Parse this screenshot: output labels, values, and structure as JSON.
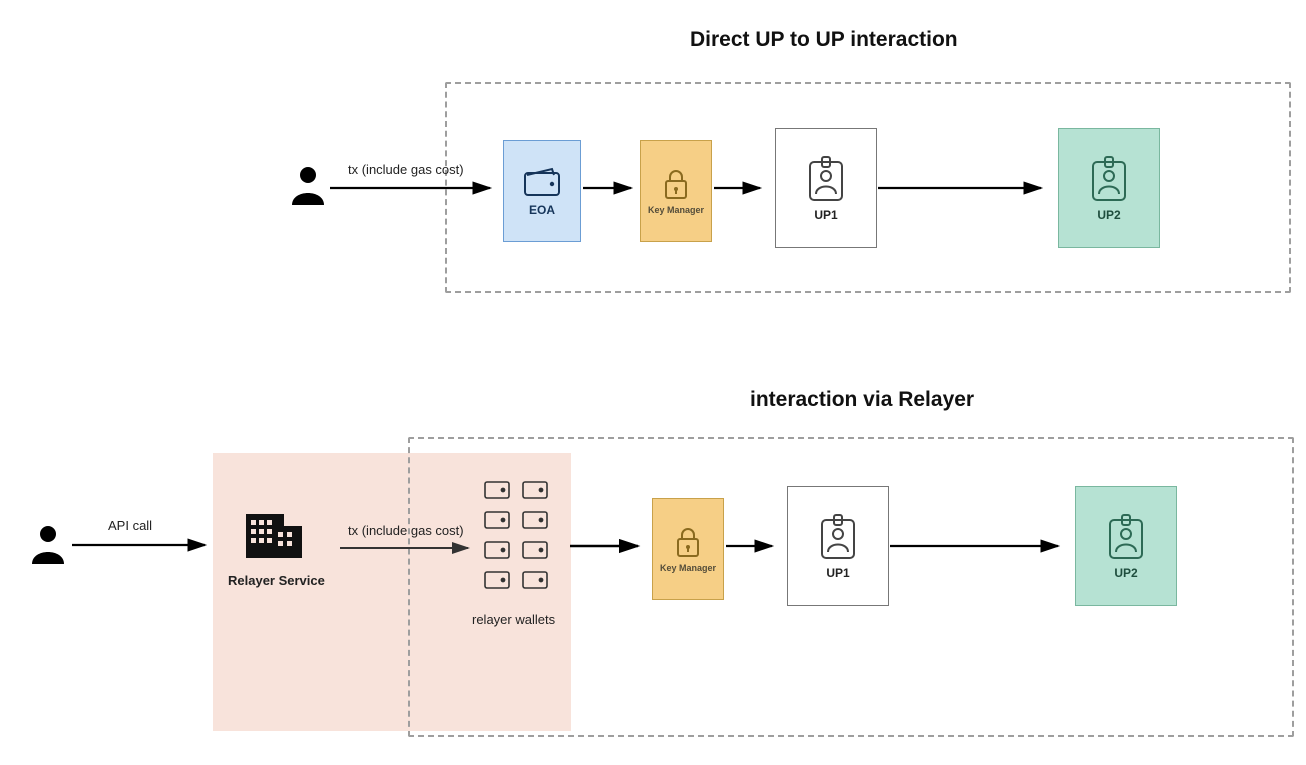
{
  "titles": {
    "top": "Direct UP to UP interaction",
    "bottom": "interaction via Relayer"
  },
  "labels": {
    "tx_gas": "tx (include gas cost)",
    "api_call": "API call",
    "relayer_service": "Relayer Service",
    "relayer_wallets": "relayer wallets"
  },
  "nodes": {
    "eoa": "EOA",
    "key_manager": "Key Manager",
    "up1": "UP1",
    "up2": "UP2"
  },
  "icons": {
    "user": "user-icon",
    "wallet": "wallet-icon",
    "lock": "lock-icon",
    "badge": "id-badge-icon",
    "building": "building-icon"
  },
  "colors": {
    "eoa_bg": "#cfe3f7",
    "km_bg": "#f6cf86",
    "up2_bg": "#b6e2d3",
    "relayer_bg": "#f8e3db",
    "dashed_border": "#9e9e9e"
  }
}
